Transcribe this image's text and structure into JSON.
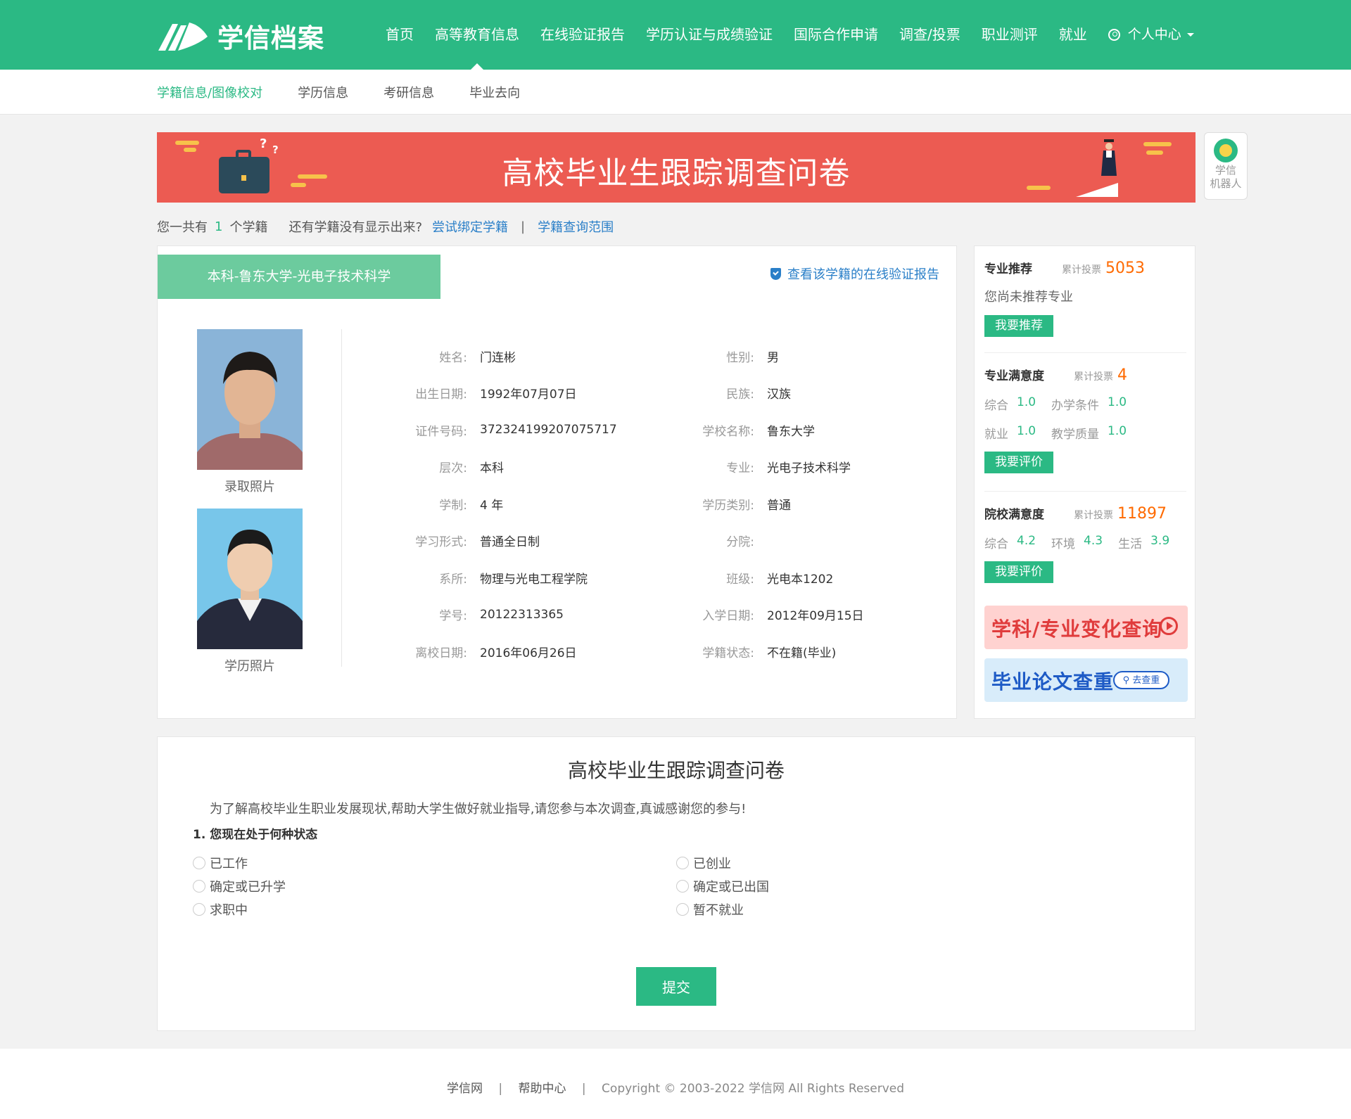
{
  "brand": {
    "name": "学信档案"
  },
  "nav": {
    "items": [
      "首页",
      "高等教育信息",
      "在线验证报告",
      "学历认证与成绩验证",
      "国际合作申请",
      "调查/投票",
      "职业测评",
      "就业"
    ],
    "active_index": 1,
    "user_menu": "个人中心"
  },
  "subnav": {
    "items": [
      "学籍信息/图像校对",
      "学历信息",
      "考研信息",
      "毕业去向"
    ],
    "active_index": 0
  },
  "banner": {
    "title": "高校毕业生跟踪调查问卷"
  },
  "robot": {
    "line1": "学信",
    "line2": "机器人"
  },
  "summary": {
    "prefix": "您一共有",
    "count": "1",
    "suffix": "个学籍",
    "question": "还有学籍没有显示出来?",
    "bind_link": "尝试绑定学籍",
    "separator": "|",
    "range_link": "学籍查询范围"
  },
  "record": {
    "tab_title": "本科-鲁东大学-光电子技术科学",
    "verify_link": "查看该学籍的在线验证报告",
    "photo1_caption": "录取照片",
    "photo2_caption": "学历照片",
    "fields": [
      {
        "label": "姓名:",
        "value": "门连彬",
        "label2": "性别:",
        "value2": "男"
      },
      {
        "label": "出生日期:",
        "value": "1992年07月07日",
        "label2": "民族:",
        "value2": "汉族"
      },
      {
        "label": "证件号码:",
        "value": "372324199207075717",
        "label2": "学校名称:",
        "value2": "鲁东大学"
      },
      {
        "label": "层次:",
        "value": "本科",
        "label2": "专业:",
        "value2": "光电子技术科学"
      },
      {
        "label": "学制:",
        "value": "4 年",
        "label2": "学历类别:",
        "value2": "普通"
      },
      {
        "label": "学习形式:",
        "value": "普通全日制",
        "label2": "分院:",
        "value2": ""
      },
      {
        "label": "系所:",
        "value": "物理与光电工程学院",
        "label2": "班级:",
        "value2": "光电本1202"
      },
      {
        "label": "学号:",
        "value": "20122313365",
        "label2": "入学日期:",
        "value2": "2012年09月15日"
      },
      {
        "label": "离校日期:",
        "value": "2016年06月26日",
        "label2": "学籍状态:",
        "value2": "不在籍(毕业)"
      }
    ]
  },
  "side": {
    "major_rec": {
      "title": "专业推荐",
      "votes_label": "累计投票",
      "votes": "5053",
      "text": "您尚未推荐专业",
      "button": "我要推荐"
    },
    "major_sat": {
      "title": "专业满意度",
      "votes_label": "累计投票",
      "votes": "4",
      "row1": [
        {
          "label": "综合",
          "value": "1.0"
        },
        {
          "label": "办学条件",
          "value": "1.0"
        }
      ],
      "row2": [
        {
          "label": "就业",
          "value": "1.0"
        },
        {
          "label": "教学质量",
          "value": "1.0"
        }
      ],
      "button": "我要评价"
    },
    "school_sat": {
      "title": "院校满意度",
      "votes_label": "累计投票",
      "votes": "11897",
      "row1": [
        {
          "label": "综合",
          "value": "4.2"
        },
        {
          "label": "环境",
          "value": "4.3"
        },
        {
          "label": "生活",
          "value": "3.9"
        }
      ],
      "button": "我要评价"
    },
    "promo1": "学科/专业变化查询",
    "promo2": "毕业论文查重",
    "promo2_pill": "去查重"
  },
  "survey": {
    "title": "高校毕业生跟踪调查问卷",
    "intro": "为了解高校毕业生职业发展现状,帮助大学生做好就业指导,请您参与本次调查,真诚感谢您的参与!",
    "question": "1. 您现在处于何种状态",
    "options_left": [
      "已工作",
      "确定或已升学",
      "求职中"
    ],
    "options_right": [
      "已创业",
      "确定或已出国",
      "暂不就业"
    ],
    "submit": "提交"
  },
  "footer": {
    "link1": "学信网",
    "separator": "|",
    "link2": "帮助中心",
    "copyright": "Copyright © 2003-2022 学信网 All Rights Reserved"
  },
  "colors": {
    "brand_green": "#2bb984",
    "banner_red": "#ec5b52",
    "link_blue": "#2a7fc8",
    "vote_orange": "#ff6a00"
  }
}
